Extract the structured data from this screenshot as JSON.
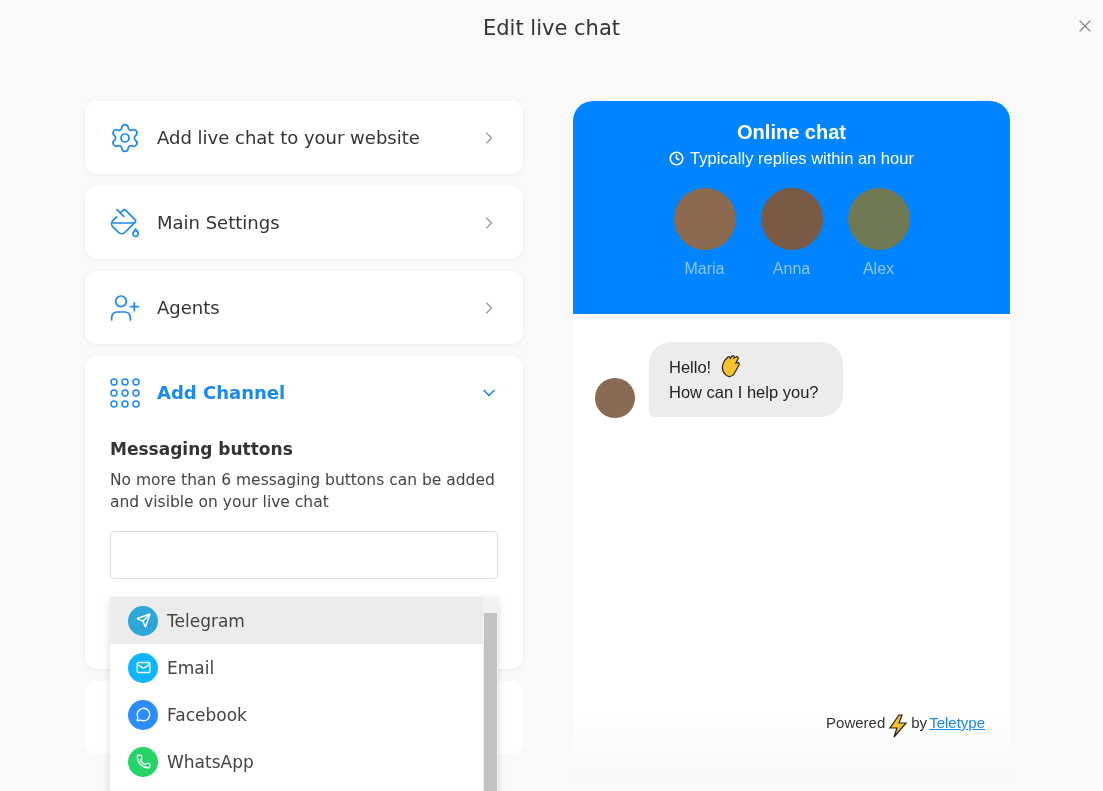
{
  "window": {
    "title": "Edit live chat"
  },
  "sections": [
    {
      "kind": "link",
      "label": "Add live chat to your website"
    },
    {
      "kind": "link",
      "label": "Main Settings"
    },
    {
      "kind": "link",
      "label": "Agents"
    },
    {
      "kind": "expandable",
      "label": "Add Channel",
      "expanded": true,
      "heading": "Messaging buttons",
      "description": "No more than 6 messaging buttons can be added and visible on your live chat"
    }
  ],
  "dropdown": {
    "options": [
      {
        "label": "Telegram",
        "color": "#2fa6da",
        "selected": true
      },
      {
        "label": "Email",
        "color": "#0fb6ff",
        "selected": false
      },
      {
        "label": "Facebook",
        "color": "#2d8cff",
        "selected": false
      },
      {
        "label": "WhatsApp",
        "color": "#25d366",
        "selected": false
      }
    ]
  },
  "preview": {
    "title": "Online chat",
    "status": "Typically replies within an hour",
    "agents": [
      {
        "name": "Maria"
      },
      {
        "name": "Anna"
      },
      {
        "name": "Alex"
      }
    ],
    "message": {
      "lines": [
        "Hello!",
        "How can I help you?"
      ]
    },
    "footer": {
      "prefix": "Powered",
      "middle": "by",
      "link": "Teletype"
    }
  }
}
